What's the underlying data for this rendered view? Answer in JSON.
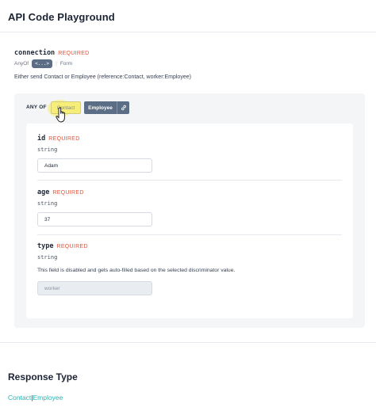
{
  "title": "API Code Playground",
  "connection": {
    "name": "connection",
    "required": "REQUIRED",
    "anyof_label": "AnyOf",
    "expand_chip": "<...>",
    "separator": "|",
    "form_label": "Form",
    "description": "Either send Contact or Employee (reference:Contact, worker:Employee)"
  },
  "anyof": {
    "label": "ANY OF",
    "tabs": [
      {
        "label": "Contact",
        "state": "hovered"
      },
      {
        "label": "Employee",
        "state": "selected"
      }
    ],
    "link_icon": "link-icon"
  },
  "fields": [
    {
      "name": "id",
      "required": "REQUIRED",
      "type": "string",
      "value": "Adam"
    },
    {
      "name": "age",
      "required": "REQUIRED",
      "type": "string",
      "value": "37"
    },
    {
      "name": "type",
      "required": "REQUIRED",
      "type": "string",
      "note": "This field is disabled and gets auto-filled based on the selected discriminator value.",
      "value": "worker",
      "disabled": true
    }
  ],
  "response": {
    "title": "Response Type",
    "types": [
      "Contact",
      "Employee"
    ],
    "separator": "|"
  },
  "colors": {
    "accent": "#5b6e86",
    "required": "#e0533b",
    "link": "#2bb3b3",
    "highlight": "#f7ee7a"
  }
}
